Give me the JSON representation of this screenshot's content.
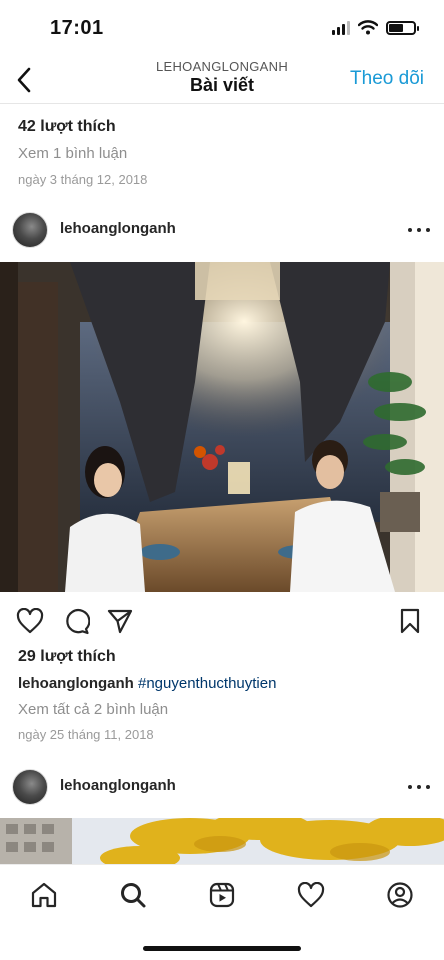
{
  "status": {
    "time": "17:01",
    "battery_level": 0.6
  },
  "topbar": {
    "username": "LEHOANGLONGANH",
    "title": "Bài viết",
    "follow_label": "Theo dõi"
  },
  "prev_post": {
    "likes": "42 lượt thích",
    "view_comments": "Xem 1 bình luận",
    "date": "ngày 3 tháng 12, 2018"
  },
  "post": {
    "username": "lehoanglonganh",
    "likes": "29 lượt thích",
    "caption_user": "lehoanglonganh",
    "caption_hashtag": "#nguyenthucthuytien",
    "view_comments": "Xem tất cả 2 bình luận",
    "date": "ngày 25 tháng 11, 2018"
  },
  "next_post": {
    "username": "lehoanglonganh"
  },
  "icons": {
    "back": "chevron-left-icon",
    "more": "more-horizontal-icon",
    "like": "heart-icon",
    "comment": "comment-icon",
    "share": "send-icon",
    "save": "bookmark-icon",
    "nav": [
      "home-icon",
      "search-icon",
      "reels-icon",
      "heart-icon",
      "profile-icon"
    ]
  },
  "colors": {
    "accent": "#1a9ad6",
    "hashtag": "#00376b",
    "secondary_text": "#8e8e8e"
  }
}
